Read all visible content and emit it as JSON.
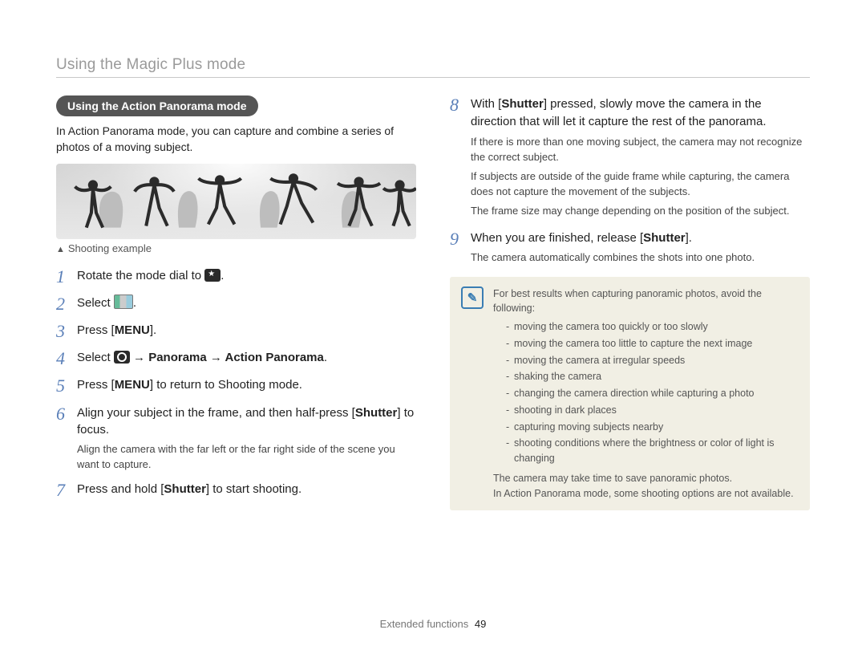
{
  "header": {
    "title": "Using the Magic Plus mode"
  },
  "section": {
    "pill": "Using the Action Panorama mode",
    "intro": "In Action Panorama mode, you can capture and combine a series of photos of a moving subject.",
    "caption": "Shooting example"
  },
  "menu_word": "MENU",
  "steps_left": [
    {
      "n": "1",
      "pre": "Rotate the mode dial to ",
      "icon": "mode",
      "post": "."
    },
    {
      "n": "2",
      "pre": "Select ",
      "icon": "select",
      "post": "."
    },
    {
      "n": "3",
      "pre": "Press [",
      "menu": true,
      "post": "]."
    },
    {
      "n": "4",
      "pre": "Select ",
      "icon": "cam",
      "bold_post": " → Panorama → Action Panorama",
      "post": "."
    },
    {
      "n": "5",
      "pre": "Press [",
      "menu": true,
      "post": "] to return to Shooting mode."
    },
    {
      "n": "6",
      "text": "Align your subject in the frame, and then half-press [",
      "bold_inline": "Shutter",
      "post_inline": "] to focus.",
      "sub": "Align the camera with the far left or the far right side of the scene you want to capture."
    },
    {
      "n": "7",
      "text": "Press and hold [",
      "bold_inline": "Shutter",
      "post_inline": "] to start shooting."
    }
  ],
  "steps_right": [
    {
      "n": "8",
      "text": "With [",
      "bold_inline": "Shutter",
      "post_inline": "] pressed, slowly move the camera in the direction that will let it capture the rest of the panorama.",
      "notes": [
        "If there is more than one moving subject, the camera may not recognize the correct subject.",
        "If subjects are outside of the guide frame while capturing, the camera does not capture the movement of the subjects.",
        "The frame size may change depending on the position of the subject."
      ]
    },
    {
      "n": "9",
      "text": "When you are finished, release [",
      "bold_inline": "Shutter",
      "post_inline": "].",
      "sub": "The camera automatically combines the shots into one photo."
    }
  ],
  "infobox": {
    "lead": "For best results when capturing panoramic photos, avoid the following:",
    "bullets": [
      "moving the camera too quickly or too slowly",
      "moving the camera too little to capture the next image",
      "moving the camera at irregular speeds",
      "shaking the camera",
      "changing the camera direction while capturing a photo",
      "shooting in dark places",
      "capturing moving subjects nearby",
      "shooting conditions where the brightness or color of light is changing"
    ],
    "trail1": "The camera may take time to save panoramic photos.",
    "trail2": "In Action Panorama mode, some shooting options are not available."
  },
  "footer": {
    "section": "Extended functions",
    "page": "49"
  }
}
